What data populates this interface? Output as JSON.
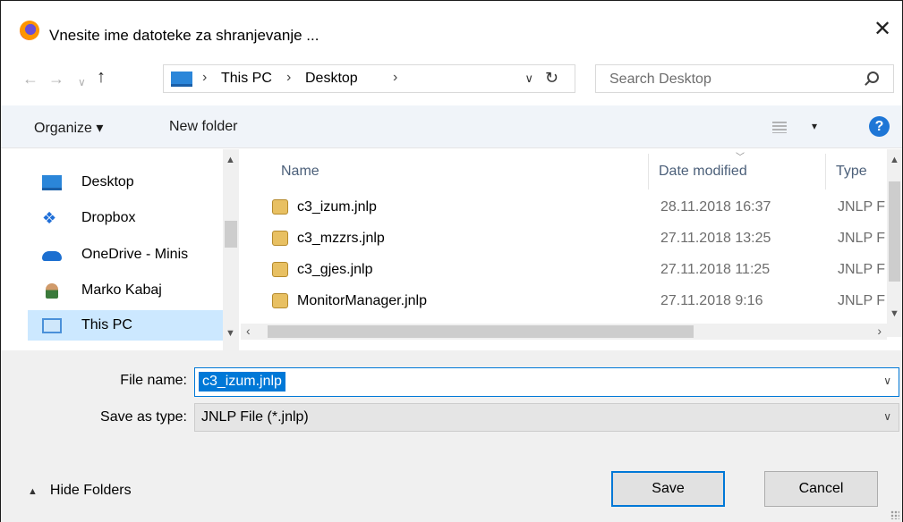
{
  "titlebar": {
    "title": "Vnesite ime datoteke za shranjevanje ...",
    "close": "✕"
  },
  "address": {
    "crumbs": [
      "This PC",
      "Desktop"
    ],
    "separator": "›",
    "search_placeholder": "Search Desktop"
  },
  "toolbar": {
    "organize": "Organize ▾",
    "new_folder": "New folder",
    "view_dropdown": "▾",
    "help": "?"
  },
  "nav": {
    "items": [
      {
        "label": "Desktop",
        "icon": "desktop-icon"
      },
      {
        "label": "Dropbox",
        "icon": "dropbox-icon"
      },
      {
        "label": "OneDrive - Minis",
        "icon": "onedrive-icon"
      },
      {
        "label": "Marko Kabaj",
        "icon": "user-icon"
      },
      {
        "label": "This PC",
        "icon": "pc-icon",
        "selected": true
      }
    ]
  },
  "files": {
    "columns": {
      "name": "Name",
      "date": "Date modified",
      "type": "Type"
    },
    "rows": [
      {
        "name": "c3_izum.jnlp",
        "date": "28.11.2018 16:37",
        "type": "JNLP F"
      },
      {
        "name": "c3_mzzrs.jnlp",
        "date": "27.11.2018 13:25",
        "type": "JNLP F"
      },
      {
        "name": "c3_gjes.jnlp",
        "date": "27.11.2018 11:25",
        "type": "JNLP F"
      },
      {
        "name": "MonitorManager.jnlp",
        "date": "27.11.2018 9:16",
        "type": "JNLP F"
      }
    ]
  },
  "form": {
    "filename_label": "File name:",
    "filename_value": "c3_izum.jnlp",
    "savetype_label": "Save as type:",
    "savetype_value": "JNLP File (*.jnlp)"
  },
  "footer": {
    "hide_folders": "Hide Folders",
    "save": "Save",
    "cancel": "Cancel"
  },
  "colors": {
    "accent": "#0078d7",
    "selection": "#cce8ff",
    "toolbar_bg": "#f0f4f9"
  }
}
